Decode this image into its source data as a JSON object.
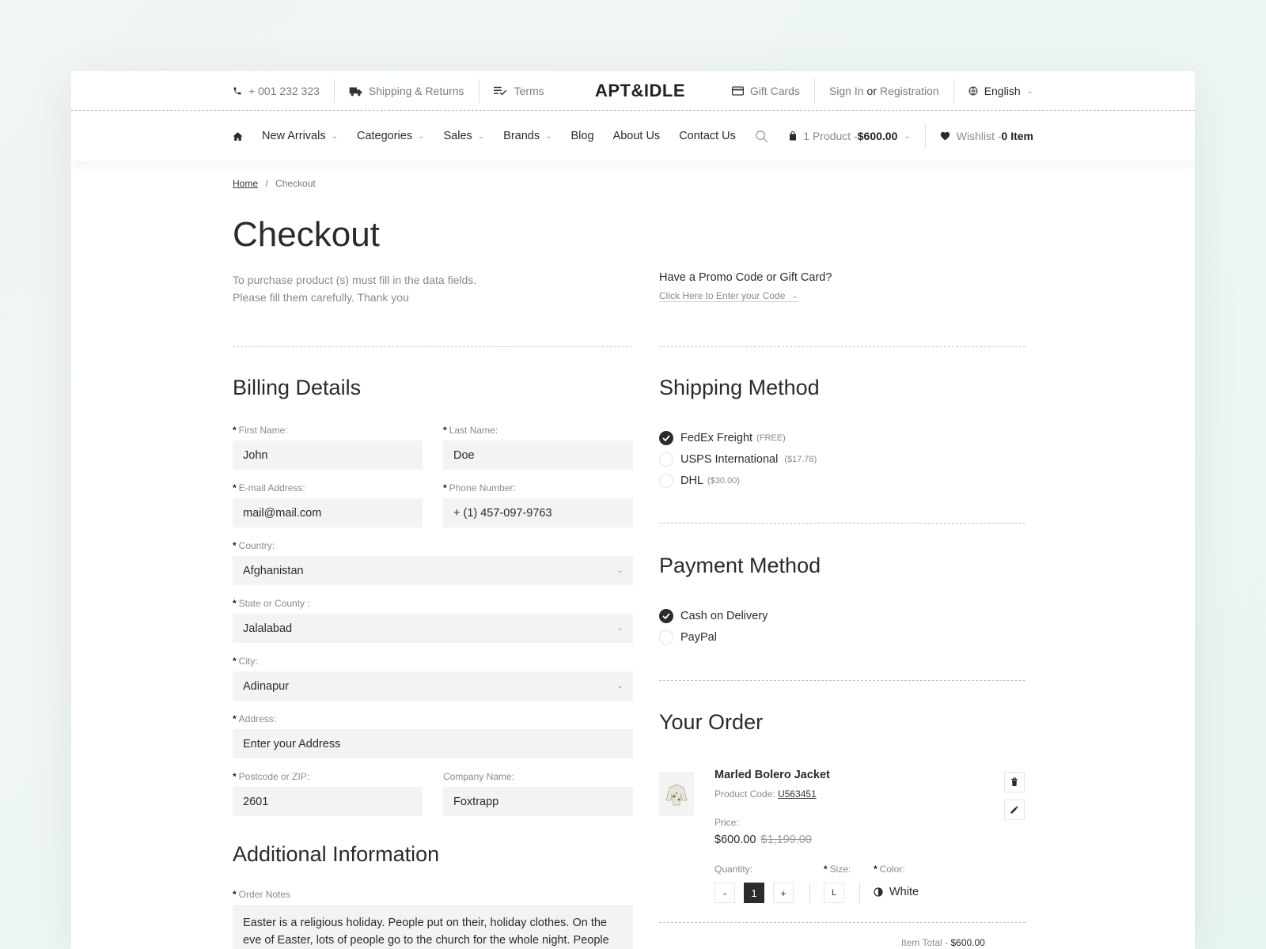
{
  "topbar": {
    "phone": "+ 001 232 323",
    "shipping": "Shipping & Returns",
    "terms": "Terms",
    "logo": "APT&IDLE",
    "gift_cards": "Gift Cards",
    "sign_in": "Sign In",
    "or": "or",
    "registration": "Registration",
    "language": "English"
  },
  "nav": {
    "items": [
      "New Arrivals",
      "Categories",
      "Sales",
      "Brands",
      "Blog",
      "About Us",
      "Contact Us"
    ],
    "cart_count": "1 Product - ",
    "cart_total": "$600.00",
    "wishlist_label": "Wishlist - ",
    "wishlist_count": "0 Item"
  },
  "breadcrumb": {
    "home": "Home",
    "sep": "/",
    "current": "Checkout"
  },
  "page": {
    "title": "Checkout",
    "intro_line1": "To purchase product (s) must fill in the data fields.",
    "intro_line2": "Please fill them carefully. Thank you",
    "promo_title": "Have a Promo Code or Gift Card?",
    "promo_link": "Click Here to Enter your Code"
  },
  "billing": {
    "title": "Billing Details",
    "first_name_label": "First Name:",
    "first_name": "John",
    "last_name_label": "Last Name:",
    "last_name": "Doe",
    "email_label": "E-mail Address:",
    "email": "mail@mail.com",
    "phone_label": "Phone Number:",
    "phone": "+ (1) 457-097-9763",
    "country_label": "Country:",
    "country": "Afghanistan",
    "state_label": "State or County :",
    "state": "Jalalabad",
    "city_label": "City:",
    "city": "Adinapur",
    "address_label": "Address:",
    "address_placeholder": "Enter your Address",
    "postcode_label": "Postcode or ZIP:",
    "postcode": "2601",
    "company_label": "Company Name:",
    "company": "Foxtrapp"
  },
  "additional": {
    "title": "Additional Information",
    "notes_label": "Order Notes",
    "notes": "Easter is a religious holiday. People put on their, holiday clothes. On the eve of Easter, lots of people go to the church for the whole night. People"
  },
  "shipping": {
    "title": "Shipping Method",
    "options": [
      {
        "label": "FedEx Freight",
        "note": "(FREE)",
        "selected": true
      },
      {
        "label": "USPS International",
        "note": "($17.78)",
        "selected": false
      },
      {
        "label": "DHL",
        "note": "($30.00)",
        "selected": false
      }
    ]
  },
  "payment": {
    "title": "Payment Method",
    "options": [
      {
        "label": "Cash on Delivery",
        "selected": true
      },
      {
        "label": "PayPal",
        "selected": false
      }
    ]
  },
  "order": {
    "title": "Your Order",
    "product_name": "Marled Bolero Jacket",
    "code_label": "Product Code:",
    "code": "U563451",
    "price_label": "Price:",
    "price": "$600.00",
    "old_price": "$1,199.00",
    "quantity_label": "Quantity:",
    "minus": "-",
    "quantity": "1",
    "plus": "+",
    "size_label": "Size:",
    "size": "L",
    "color_label": "Color:",
    "color": "White",
    "item_total_label": "Item Total - ",
    "item_total": "$600.00"
  },
  "colors": {
    "accent": "#2b2b2b",
    "input_bg": "#f2f3f4",
    "muted": "#8a8a8a"
  },
  "icons": [
    "phone-icon",
    "truck-icon",
    "checklist-icon",
    "card-icon",
    "globe-icon",
    "home-icon",
    "search-icon",
    "bag-icon",
    "heart-icon",
    "trash-icon",
    "pencil-icon",
    "contrast-icon",
    "check-icon"
  ]
}
